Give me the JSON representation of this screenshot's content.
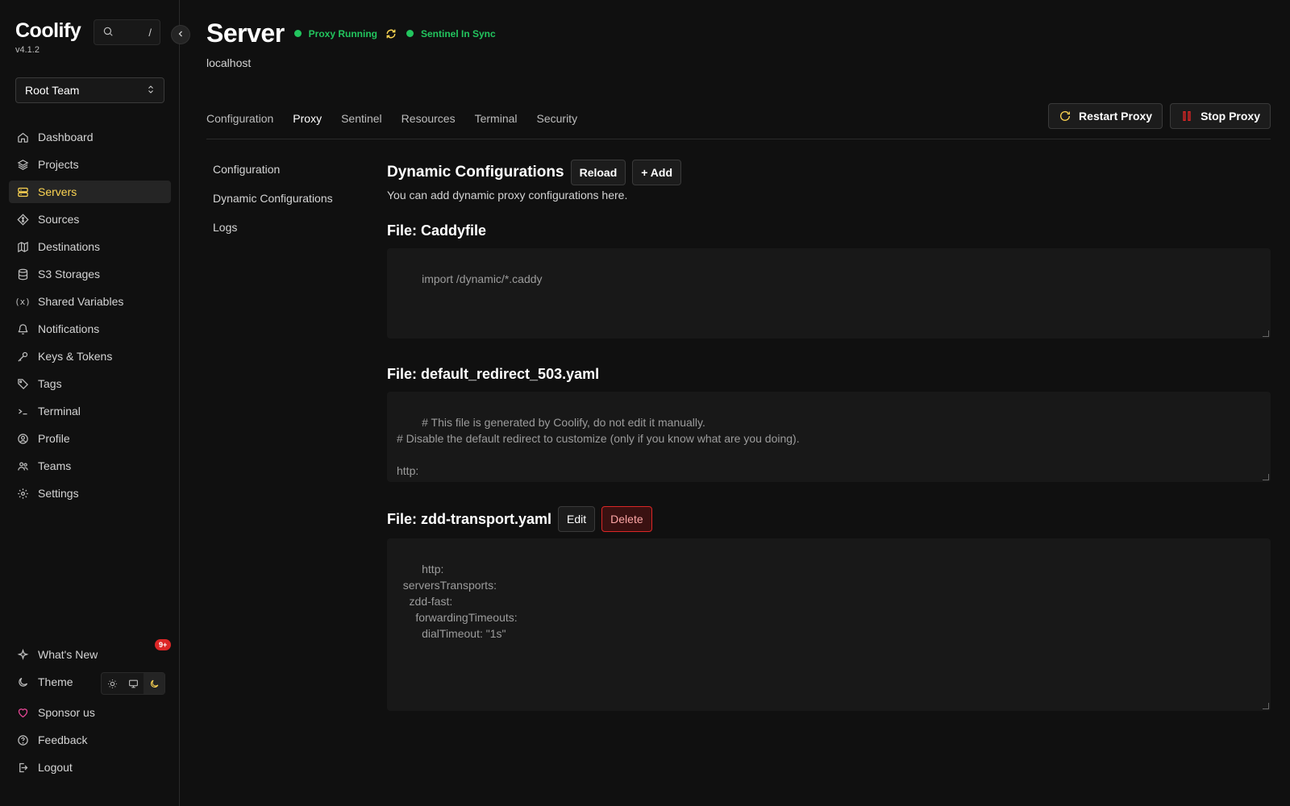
{
  "app": {
    "name": "Coolify",
    "version": "v4.1.2"
  },
  "search": {
    "shortcut": "/"
  },
  "team": {
    "selected": "Root Team"
  },
  "sidebar": {
    "items": [
      {
        "label": "Dashboard",
        "icon": "home-icon"
      },
      {
        "label": "Projects",
        "icon": "layers-icon"
      },
      {
        "label": "Servers",
        "icon": "server-icon"
      },
      {
        "label": "Sources",
        "icon": "git-icon"
      },
      {
        "label": "Destinations",
        "icon": "destination-icon"
      },
      {
        "label": "S3 Storages",
        "icon": "database-icon"
      },
      {
        "label": "Shared Variables",
        "icon": "variable-icon"
      },
      {
        "label": "Notifications",
        "icon": "bell-icon"
      },
      {
        "label": "Keys & Tokens",
        "icon": "key-icon"
      },
      {
        "label": "Tags",
        "icon": "tag-icon"
      },
      {
        "label": "Terminal",
        "icon": "terminal-icon"
      },
      {
        "label": "Profile",
        "icon": "user-circle-icon"
      },
      {
        "label": "Teams",
        "icon": "users-icon"
      },
      {
        "label": "Settings",
        "icon": "gear-icon"
      }
    ],
    "active": "Servers",
    "whats_new": {
      "label": "What's New",
      "badge": "9+"
    },
    "theme": {
      "label": "Theme"
    },
    "sponsor": {
      "label": "Sponsor us"
    },
    "feedback": {
      "label": "Feedback"
    },
    "logout": {
      "label": "Logout"
    }
  },
  "header": {
    "title": "Server",
    "proxy_status": "Proxy Running",
    "sentinel_status": "Sentinel In Sync",
    "server_name": "localhost"
  },
  "tabs": [
    "Configuration",
    "Proxy",
    "Sentinel",
    "Resources",
    "Terminal",
    "Security"
  ],
  "active_tab": "Proxy",
  "actions": {
    "restart": "Restart Proxy",
    "stop": "Stop Proxy"
  },
  "subnav": [
    "Configuration",
    "Dynamic Configurations",
    "Logs"
  ],
  "dynamic": {
    "title": "Dynamic Configurations",
    "reload": "Reload",
    "add": "+ Add",
    "description": "You can add dynamic proxy configurations here."
  },
  "files": [
    {
      "title": "File: Caddyfile",
      "content": "import /dynamic/*.caddy"
    },
    {
      "title": "File: default_redirect_503.yaml",
      "content": "# This file is generated by Coolify, do not edit it manually.\n# Disable the default redirect to customize (only if you know what are you doing).\n\nhttp:\n  routers:\n    catchall:"
    },
    {
      "title": "File: zdd-transport.yaml",
      "content": "http:\n  serversTransports:\n    zdd-fast:\n      forwardingTimeouts:\n        dialTimeout: \"1s\"",
      "edit": "Edit",
      "delete": "Delete"
    }
  ],
  "colors": {
    "accent": "#fcd452",
    "success": "#22c55e",
    "danger": "#dc2626"
  }
}
